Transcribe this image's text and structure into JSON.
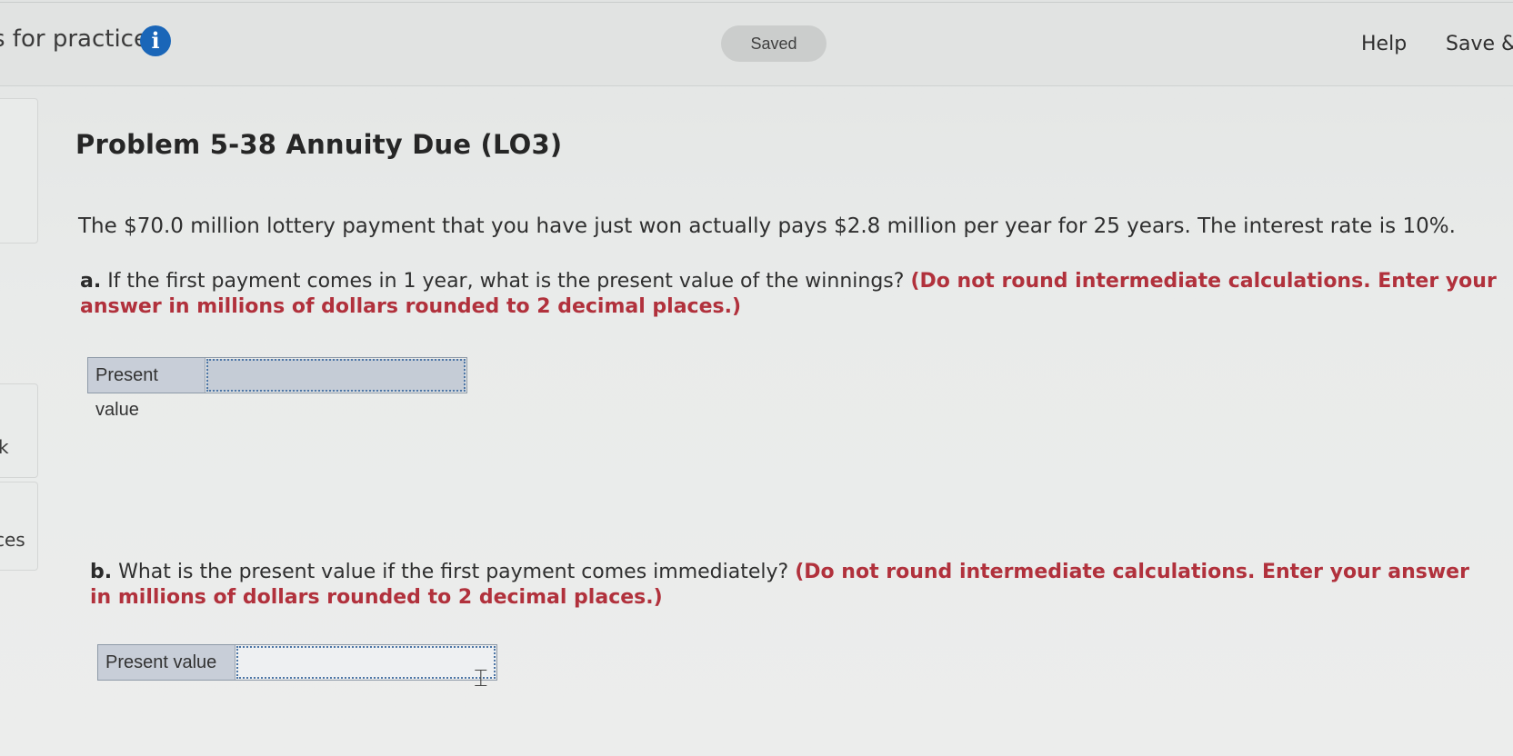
{
  "header": {
    "title_partial": "s for practice",
    "info_icon": "info-icon",
    "saved_status": "Saved",
    "help_label": "Help",
    "save_exit_label": "Save &"
  },
  "sidebar": {
    "items": [
      {
        "label": "k"
      },
      {
        "label": "ces"
      }
    ]
  },
  "problem": {
    "title": "Problem 5-38 Annuity Due (LO3)",
    "stem": "The $70.0 million lottery payment that you have just won actually pays $2.8 million per year for 25 years. The interest rate is 10%.",
    "part_a": {
      "letter": "a.",
      "question": " If the first payment comes in 1 year, what is the present value of the winnings? ",
      "instruction": "(Do not round intermediate calculations. Enter your answer in millions of dollars rounded to 2 decimal places.)",
      "input_label": "Present value",
      "input_value": ""
    },
    "part_b": {
      "letter": "b.",
      "question": " What is the present value if the first payment comes immediately? ",
      "instruction": "(Do not round intermediate calculations. Enter your answer in millions of dollars rounded to 2 decimal places.)",
      "input_label": "Present value",
      "input_value": ""
    }
  },
  "colors": {
    "accent_blue": "#1a66b8",
    "instruction_red": "#b1313c",
    "input_label_bg": "#c8ced8"
  }
}
